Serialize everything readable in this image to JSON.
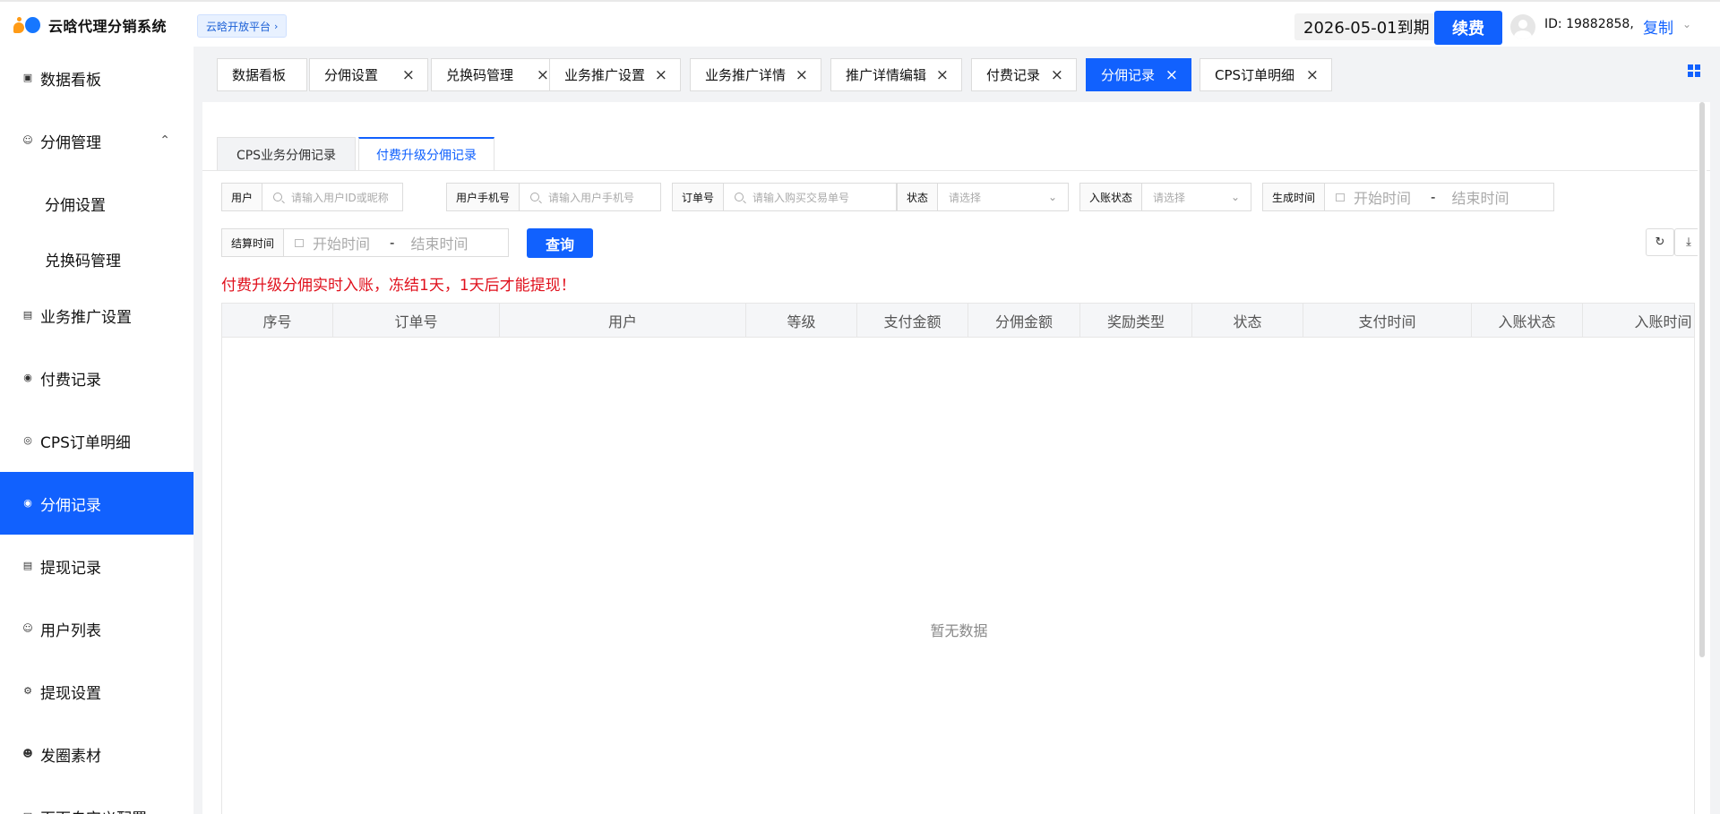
{
  "app": {
    "title": "云晗代理分销系统",
    "platform_label": "云晗开放平台",
    "expire_text": "2026-05-01到期",
    "renew_label": "续费",
    "user_id": "ID: 19882858,",
    "copy_label": "复制"
  },
  "sidebar": {
    "items": [
      {
        "label": "数据看板",
        "icon": "monitor-icon"
      },
      {
        "label": "分佣管理",
        "icon": "user-icon"
      },
      {
        "label": "分佣设置"
      },
      {
        "label": "兑换码管理"
      },
      {
        "label": "业务推广设置",
        "icon": "box-icon"
      },
      {
        "label": "付费记录",
        "icon": "record-icon"
      },
      {
        "label": "CPS订单明细",
        "icon": "cps-icon"
      },
      {
        "label": "分佣记录",
        "icon": "circle-icon"
      },
      {
        "label": "提现记录",
        "icon": "doc-icon"
      },
      {
        "label": "用户列表",
        "icon": "user-icon"
      },
      {
        "label": "提现设置",
        "icon": "settings-icon"
      },
      {
        "label": "发圈素材",
        "icon": "people-icon"
      },
      {
        "label": "页面自定义配置",
        "icon": "page-icon"
      }
    ]
  },
  "page_tabs": [
    {
      "label": "数据看板"
    },
    {
      "label": "分佣设置"
    },
    {
      "label": "兑换码管理"
    },
    {
      "label": "业务推广设置"
    },
    {
      "label": "业务推广详情"
    },
    {
      "label": "推广详情编辑"
    },
    {
      "label": "付费记录"
    },
    {
      "label": "分佣记录"
    },
    {
      "label": "CPS订单明细"
    }
  ],
  "sub_tabs": [
    {
      "label": "CPS业务分佣记录"
    },
    {
      "label": "付费升级分佣记录"
    }
  ],
  "filters": {
    "user": {
      "label": "用户",
      "placeholder": "请输入用户ID或昵称"
    },
    "phone": {
      "label": "用户手机号",
      "placeholder": "请输入用户手机号"
    },
    "order": {
      "label": "订单号",
      "placeholder": "请输入购买交易单号"
    },
    "status": {
      "label": "状态",
      "placeholder": "请选择"
    },
    "account_status": {
      "label": "入账状态",
      "placeholder": "请选择"
    },
    "created": {
      "label": "生成时间",
      "start": "开始时间",
      "sep": "-",
      "end": "结束时间"
    },
    "settled": {
      "label": "结算时间",
      "start": "开始时间",
      "sep": "-",
      "end": "结束时间"
    },
    "query_label": "查询"
  },
  "notice": "付费升级分佣实时入账，冻结1天，1天后才能提现！",
  "table": {
    "columns": [
      "序号",
      "订单号",
      "用户",
      "等级",
      "支付金额",
      "分佣金额",
      "奖励类型",
      "状态",
      "支付时间",
      "入账状态",
      "入账时间"
    ],
    "empty_text": "暂无数据"
  },
  "colors": {
    "primary": "#1161fe",
    "notice": "#e0101c"
  }
}
